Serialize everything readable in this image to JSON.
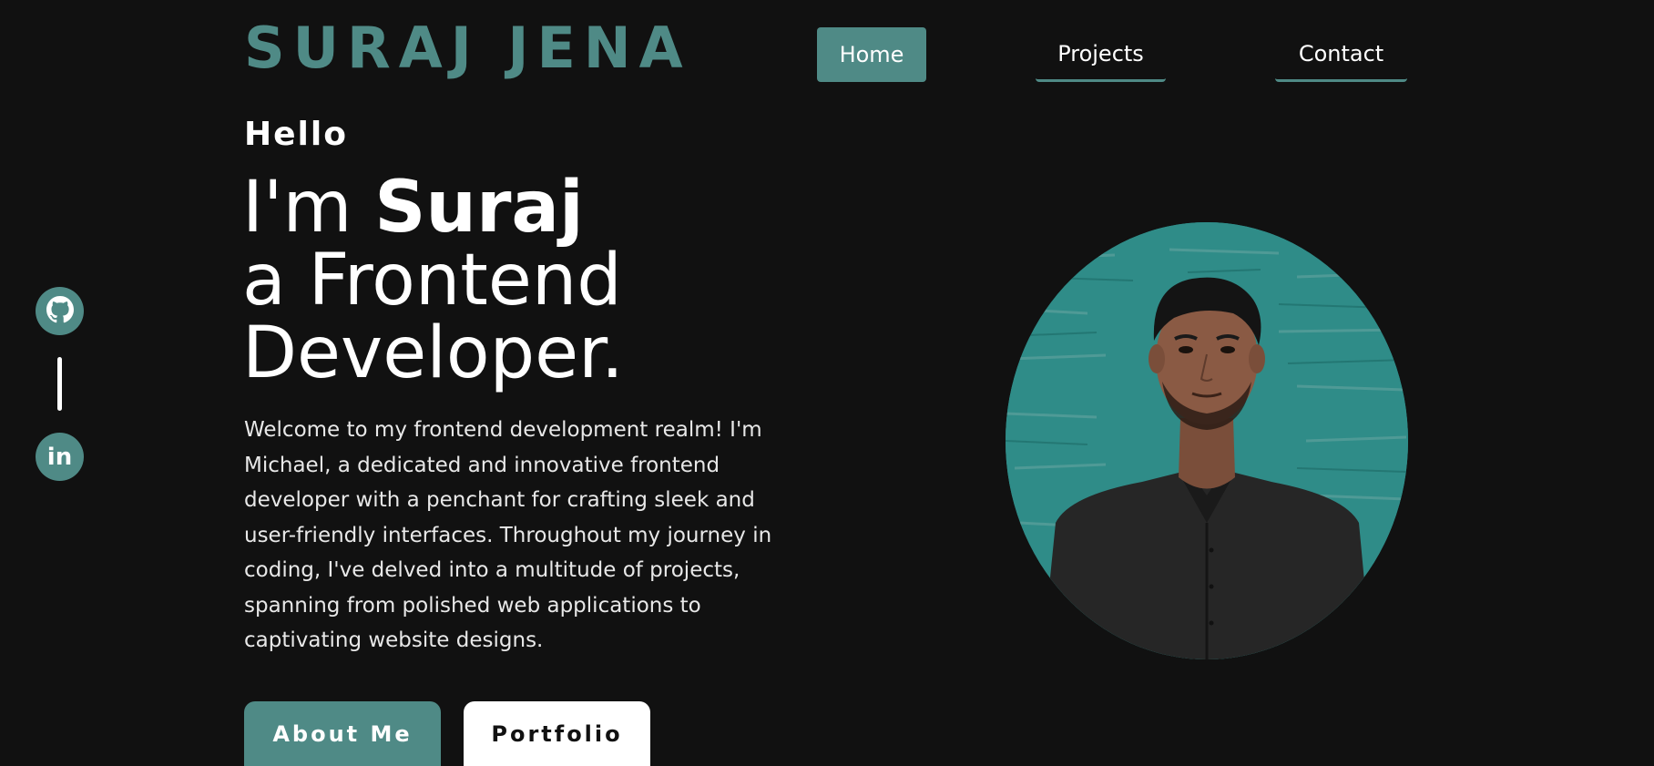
{
  "header": {
    "brand": "SURAJ JENA",
    "nav": [
      {
        "label": "Home",
        "active": true
      },
      {
        "label": "Projects",
        "active": false
      },
      {
        "label": "Contact",
        "active": false
      }
    ]
  },
  "social": [
    {
      "icon": "github-icon"
    },
    {
      "icon": "linkedin-icon",
      "glyph": "in"
    }
  ],
  "hero": {
    "greeting": "Hello",
    "headline_prefix": "I'm ",
    "headline_name": "Suraj",
    "headline_line2": "a Frontend",
    "headline_line3": "Developer.",
    "intro": "Welcome to my frontend development realm! I'm Michael, a dedicated and innovative frontend developer with a penchant for crafting sleek and user-friendly interfaces. Throughout my journey in coding, I've delved into a multitude of projects, spanning from polished web applications to captivating website designs.",
    "buttons": {
      "about": "About Me",
      "portfolio": "Portfolio"
    }
  },
  "colors": {
    "background": "#111111",
    "accent": "#4f8a86",
    "text": "#ffffff",
    "button_light": "#ffffff"
  }
}
